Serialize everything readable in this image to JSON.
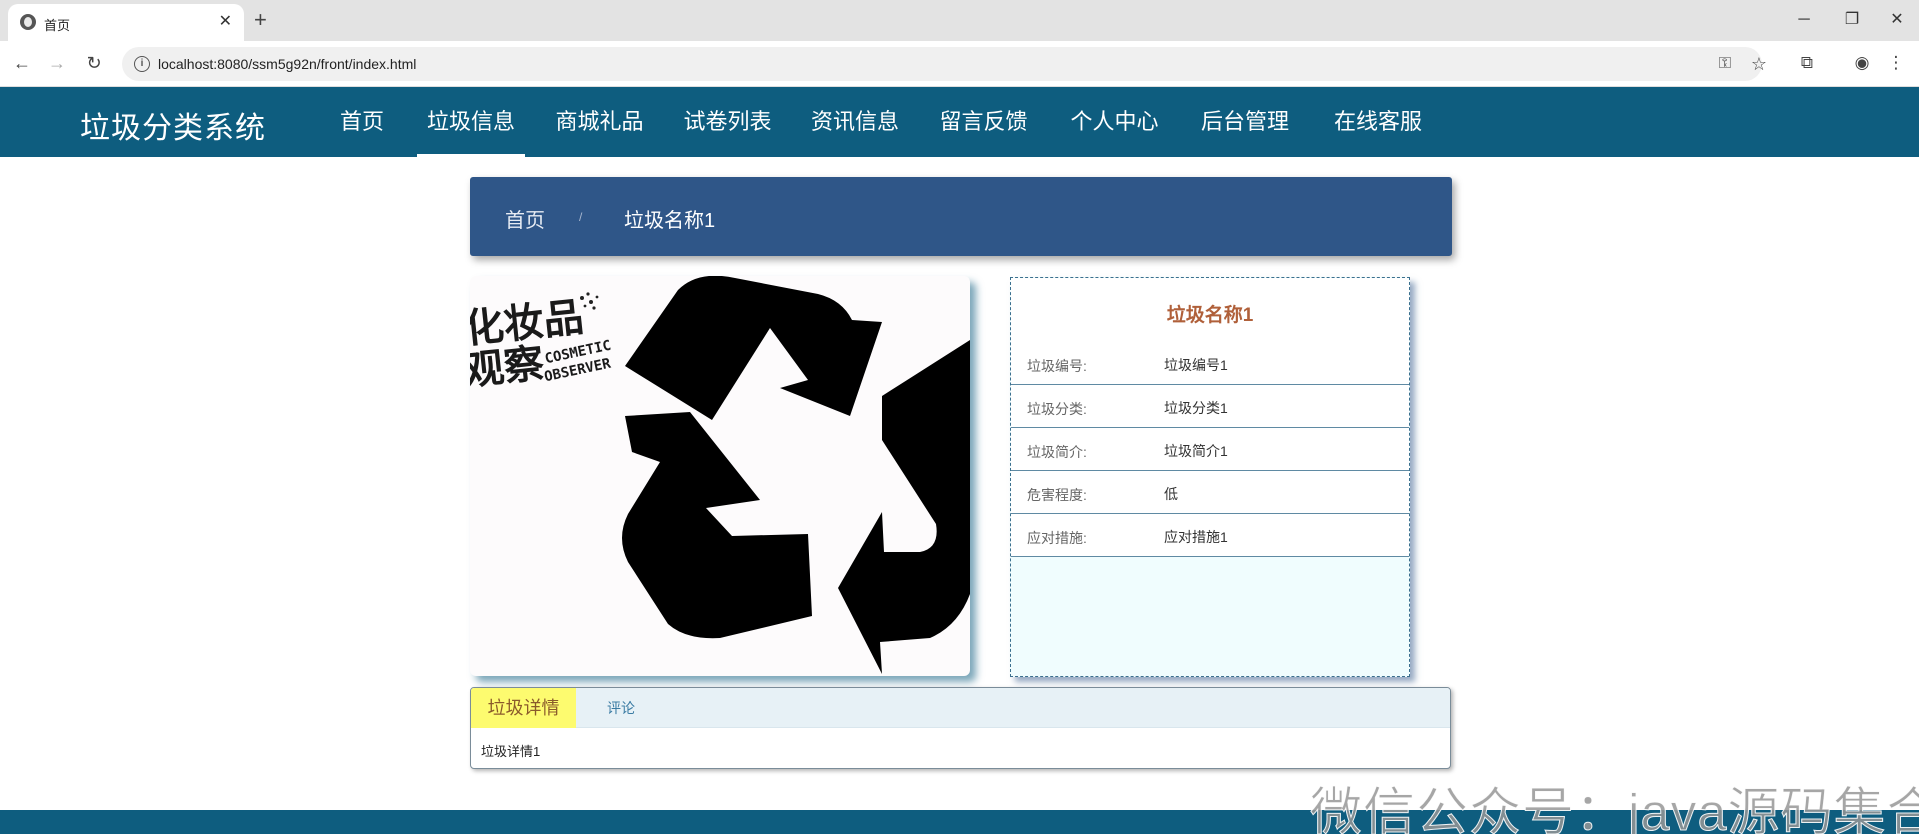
{
  "browser": {
    "tab_title": "首页",
    "url": "localhost:8080/ssm5g92n/front/index.html"
  },
  "site": {
    "title": "垃圾分类系统",
    "nav": [
      {
        "label": "首页"
      },
      {
        "label": "垃圾信息",
        "active": true
      },
      {
        "label": "商城礼品"
      },
      {
        "label": "试卷列表"
      },
      {
        "label": "资讯信息"
      },
      {
        "label": "留言反馈"
      },
      {
        "label": "个人中心"
      },
      {
        "label": "后台管理"
      },
      {
        "label": "在线客服"
      }
    ]
  },
  "breadcrumb": {
    "home": "首页",
    "separator": "/",
    "current": "垃圾名称1"
  },
  "image": {
    "overlay_text_cn_1": "化妆品",
    "overlay_text_cn_2": "观察",
    "overlay_text_en_1": "COSMETIC",
    "overlay_text_en_2": "OBSERVER",
    "icon": "recycle-icon"
  },
  "info": {
    "title": "垃圾名称1",
    "rows": [
      {
        "label": "垃圾编号:",
        "value": "垃圾编号1"
      },
      {
        "label": "垃圾分类:",
        "value": "垃圾分类1"
      },
      {
        "label": "垃圾简介:",
        "value": "垃圾简介1"
      },
      {
        "label": "危害程度:",
        "value": "低"
      },
      {
        "label": "应对措施:",
        "value": "应对措施1"
      }
    ]
  },
  "detail": {
    "tabs": [
      {
        "label": "垃圾详情",
        "active": true
      },
      {
        "label": "评论"
      }
    ],
    "content": "垃圾详情1"
  },
  "watermark": "微信公众号：java源码集合",
  "colors": {
    "header": "#0e5d7f",
    "breadcrumb": "#2f5688",
    "info_title": "#b0603a",
    "active_tab": "#fdfb6f"
  }
}
